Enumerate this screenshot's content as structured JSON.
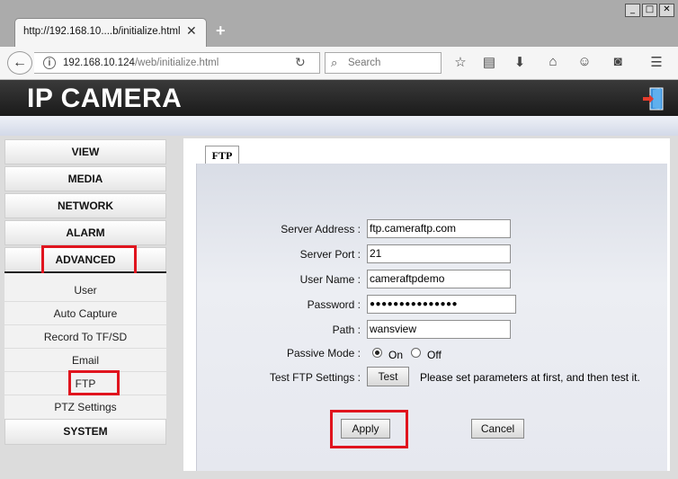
{
  "browser": {
    "tab_title": "http://192.168.10....b/initialize.html",
    "url_host": "192.168.10.124",
    "url_path": "/web/initialize.html",
    "search_placeholder": "Search",
    "window_controls": [
      "_",
      "□",
      "✕"
    ]
  },
  "banner": {
    "title": "IP CAMERA"
  },
  "sidebar": {
    "menu": [
      {
        "label": "VIEW"
      },
      {
        "label": "MEDIA"
      },
      {
        "label": "NETWORK"
      },
      {
        "label": "ALARM"
      },
      {
        "label": "ADVANCED"
      }
    ],
    "submenu": [
      "User",
      "Auto Capture",
      "Record To TF/SD",
      "Email",
      "FTP",
      "PTZ Settings"
    ],
    "system_label": "SYSTEM"
  },
  "ftp": {
    "tab_label": "FTP",
    "server_address_label": "Server Address :",
    "server_address": "ftp.cameraftp.com",
    "server_port_label": "Server Port :",
    "server_port": "21",
    "user_name_label": "User Name :",
    "user_name": "cameraftpdemo",
    "password_label": "Password :",
    "password": "●●●●●●●●●●●●●●●",
    "path_label": "Path :",
    "path": "wansview",
    "passive_mode_label": "Passive Mode :",
    "passive_on": "On",
    "passive_off": "Off",
    "passive_selected": "On",
    "test_label": "Test FTP Settings :",
    "test_button": "Test",
    "test_hint": "Please set parameters at first, and then test it.",
    "apply_button": "Apply",
    "cancel_button": "Cancel"
  },
  "colors": {
    "highlight": "#e0141e",
    "banner": "#1a1a1a"
  }
}
